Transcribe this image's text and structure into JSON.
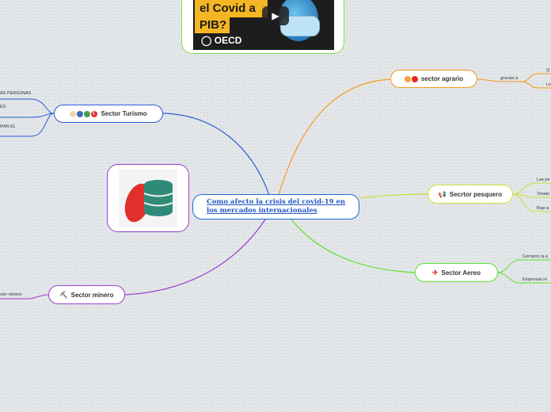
{
  "central": {
    "title": "Como afecto la crisis del covid-19 en los mercados internacionales"
  },
  "video": {
    "title_line1": "el Covid a",
    "title_line2": "PIB?",
    "logo": "OECD",
    "play_icon": "play-icon"
  },
  "image_node": {
    "icon": "coin-stack-icon",
    "colors": {
      "red": "#e0302c",
      "teal": "#2f8b78"
    }
  },
  "topics": {
    "agrario": {
      "label": "sector agrario",
      "icons": [
        "mango-icon",
        "tomato-icon"
      ],
      "color": "#f39a1c"
    },
    "turismo": {
      "label": "Sector Turismo",
      "icons": [
        "egg-icon",
        "globe-icon",
        "green-icon",
        "turkey-flag-icon"
      ],
      "color": "#2d5bd9"
    },
    "pesquero": {
      "label": "Secrtor pesquero",
      "icons": [
        "megaphone-icon"
      ],
      "color": "#c8e03a"
    },
    "aereo": {
      "label": "Sector Aereo",
      "icons": [
        "airplane-icon"
      ],
      "color": "#5be12b"
    },
    "minero": {
      "label": "Sector minero",
      "icons": [
        "pickaxe-icon"
      ],
      "color": "#9b3fd2"
    }
  },
  "leaves": {
    "agrario": [
      "gracias a",
      "Q",
      "Lo"
    ],
    "turismo": [
      "AS PERSONAS",
      "ES",
      "RAN EL"
    ],
    "pesquero": [
      "Las pe",
      "Tenian",
      "Bajo a"
    ],
    "aereo": [
      "Cerraron la a",
      "Empresas re"
    ],
    "minero": [
      "ctor minero"
    ]
  }
}
